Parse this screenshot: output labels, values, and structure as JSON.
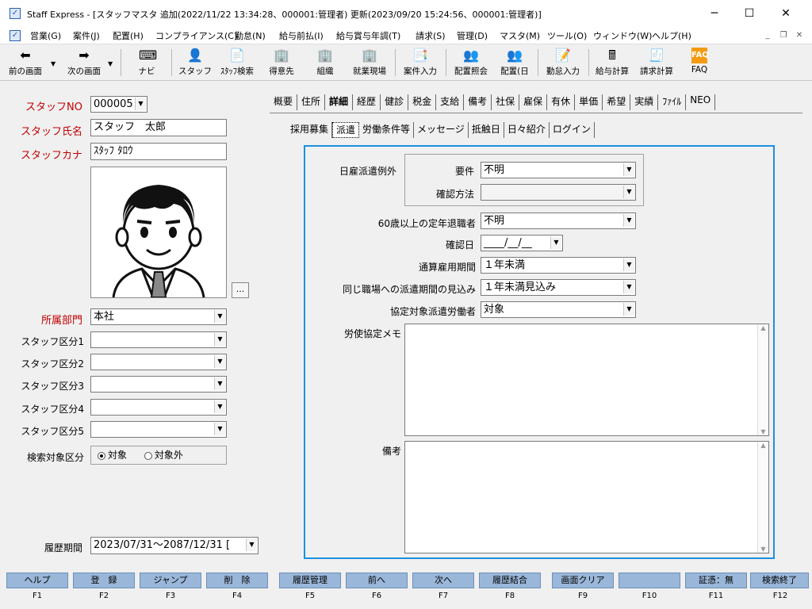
{
  "window": {
    "title": "Staff Express - [スタッフマスタ  追加(2022/11/22 13:34:28、000001:管理者) 更新(2023/09/20 15:24:56、000001:管理者)]"
  },
  "menu": [
    "営業(G)",
    "案件(J)",
    "配置(H)",
    "コンプライアンス(C)",
    "勤怠(N)",
    "給与前払(I)",
    "給与賞与年調(T)",
    "請求(S)",
    "管理(D)",
    "マスタ(M)",
    "ツール(O)",
    "ウィンドウ(W)",
    "ヘルプ(H)"
  ],
  "toolbar": {
    "back": "前の画面",
    "next": "次の画面",
    "navi": "ナビ",
    "staff": "スタッフ",
    "staff_search": "ｽﾀｯﾌ検索",
    "client": "得意先",
    "org": "組織",
    "site": "就業現場",
    "case_input": "案件入力",
    "assign_view": "配置照会",
    "assign_day": "配置(日",
    "attendance_input": "勤怠入力",
    "payroll_calc": "給与計算",
    "billing_calc": "請求計算",
    "faq": "FAQ"
  },
  "left": {
    "staff_no_label": "スタッフNO",
    "staff_no": "000005",
    "name_label": "スタッフ氏名",
    "name": "スタッフ　太郎",
    "kana_label": "スタッフカナ",
    "kana": "ｽﾀｯﾌ ﾀﾛｳ",
    "photo_btn": "...",
    "dept_label": "所属部門",
    "dept": "本社",
    "kubun": [
      {
        "label": "スタッフ区分1",
        "value": ""
      },
      {
        "label": "スタッフ区分2",
        "value": ""
      },
      {
        "label": "スタッフ区分3",
        "value": ""
      },
      {
        "label": "スタッフ区分4",
        "value": ""
      },
      {
        "label": "スタッフ区分5",
        "value": ""
      }
    ],
    "search_label": "検索対象区分",
    "search_opt1": "対象",
    "search_opt2": "対象外",
    "history_label": "履歴期間",
    "history": "2023/07/31～2087/12/31 ["
  },
  "tabs": [
    "概要",
    "住所",
    "詳細",
    "経歴",
    "健診",
    "税金",
    "支給",
    "備考",
    "社保",
    "雇保",
    "有休",
    "単価",
    "希望",
    "実績",
    "ﾌｧｲﾙ",
    "NEO"
  ],
  "subtabs": [
    "採用募集",
    "派遣",
    "労働条件等",
    "メッセージ",
    "抵触日",
    "日々紹介",
    "ログイン"
  ],
  "form": {
    "daily_label": "日雇派遣例外",
    "req_label": "要件",
    "req": "不明",
    "confirm_method_label": "確認方法",
    "confirm_method": "",
    "retire_label": "60歳以上の定年退職者",
    "retire": "不明",
    "confirm_date_label": "確認日",
    "confirm_date": "____/__/__",
    "total_period_label": "通算雇用期間",
    "total_period": "１年未満",
    "same_place_label": "同じ職場への派遣期間の見込み",
    "same_place": "１年未満見込み",
    "agreement_label": "協定対象派遣労働者",
    "agreement": "対象",
    "memo_label": "労使協定メモ",
    "remarks_label": "備考"
  },
  "fkeys": [
    {
      "label": "ヘルプ",
      "num": "F1"
    },
    {
      "label": "登　録",
      "num": "F2"
    },
    {
      "label": "ジャンプ",
      "num": "F3"
    },
    {
      "label": "削　除",
      "num": "F4"
    },
    {
      "label": "履歴管理",
      "num": "F5"
    },
    {
      "label": "前へ",
      "num": "F6"
    },
    {
      "label": "次へ",
      "num": "F7"
    },
    {
      "label": "履歴結合",
      "num": "F8"
    },
    {
      "label": "画面クリア",
      "num": "F9"
    },
    {
      "label": "",
      "num": "F10"
    },
    {
      "label": "証憑：無",
      "num": "F11"
    },
    {
      "label": "検索終了",
      "num": "F12"
    }
  ]
}
